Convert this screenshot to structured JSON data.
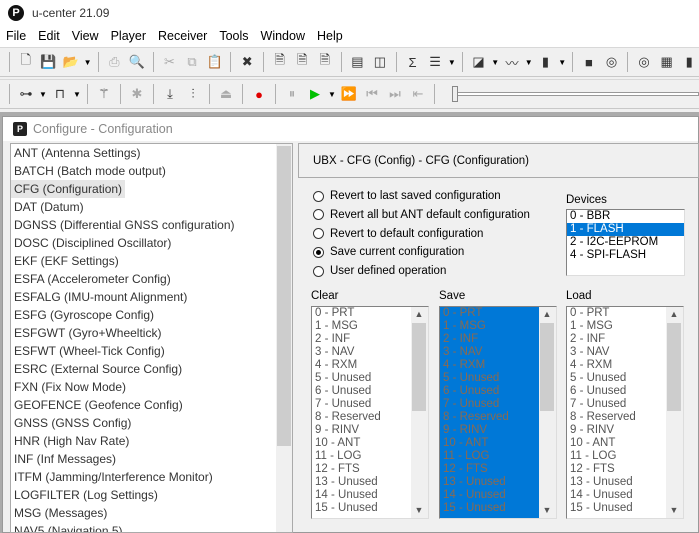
{
  "app": {
    "icon": "P",
    "title": "u-center 21.09"
  },
  "menu": [
    "File",
    "Edit",
    "View",
    "Player",
    "Receiver",
    "Tools",
    "Window",
    "Help"
  ],
  "toolbar1": [
    "new-file-icon",
    "save-icon",
    "open-icon",
    "print-icon",
    "print-preview-icon",
    "cut-icon",
    "copy-icon",
    "paste-icon",
    "clear-icon",
    "new-db-icon",
    "binary-doc-icon",
    "text-doc-icon",
    "layout-icon",
    "panel-icon",
    "statistics-icon",
    "table-icon",
    "sky-view-icon",
    "chart-icon",
    "histogram-icon",
    "map-view-icon",
    "deviation-icon",
    "compass-icon",
    "grid-icon",
    "bar-view-icon"
  ],
  "toolbar2": [
    "connection-icon",
    "baudrate-icon",
    "autobaud-wand-icon",
    "debug-bug-icon",
    "download-icon",
    "config-sliders-icon",
    "eject-icon",
    "record-icon",
    "pause-icon",
    "play-icon",
    "fast-forward-icon",
    "step-back-icon",
    "step-forward-icon",
    "rewind-icon"
  ],
  "child": {
    "icon": "P",
    "title": "Configure - Configuration"
  },
  "messages": [
    "ANT (Antenna Settings)",
    "BATCH (Batch mode output)",
    "CFG (Configuration)",
    "DAT (Datum)",
    "DGNSS (Differential GNSS configuration)",
    "DOSC (Disciplined Oscillator)",
    "EKF (EKF Settings)",
    "ESFA (Accelerometer Config)",
    "ESFALG (IMU-mount Alignment)",
    "ESFG (Gyroscope Config)",
    "ESFGWT (Gyro+Wheeltick)",
    "ESFWT (Wheel-Tick Config)",
    "ESRC (External Source Config)",
    "FXN (Fix Now Mode)",
    "GEOFENCE (Geofence Config)",
    "GNSS (GNSS Config)",
    "HNR (High Nav Rate)",
    "INF (Inf Messages)",
    "ITFM (Jamming/Interference Monitor)",
    "LOGFILTER (Log Settings)",
    "MSG (Messages)",
    "NAV5 (Navigation 5)"
  ],
  "selected_message": "CFG (Configuration)",
  "header": "UBX - CFG (Config) - CFG (Configuration)",
  "radios": [
    {
      "label": "Revert to last saved configuration",
      "checked": false
    },
    {
      "label": "Revert all but ANT default configuration",
      "checked": false
    },
    {
      "label": "Revert to default configuration",
      "checked": false
    },
    {
      "label": "Save current configuration",
      "checked": true
    },
    {
      "label": "User defined operation",
      "checked": false
    }
  ],
  "devices": {
    "label": "Devices",
    "items": [
      "0 - BBR",
      "1 - FLASH",
      "2 - I2C-EEPROM",
      "4 - SPI-FLASH"
    ],
    "selected": "1 - FLASH"
  },
  "sections": [
    "0 - PRT",
    "1 - MSG",
    "2 - INF",
    "3 - NAV",
    "4 - RXM",
    "5 - Unused",
    "6 - Unused",
    "7 - Unused",
    "8 - Reserved",
    "9 - RINV",
    "10 - ANT",
    "11 - LOG",
    "12 - FTS",
    "13 - Unused",
    "14 - Unused",
    "15 - Unused"
  ],
  "lists": {
    "clear": "Clear",
    "save": "Save",
    "load": "Load"
  },
  "colors": {
    "selection": "#0078d7",
    "record": "#e00000",
    "play": "#00c000"
  }
}
